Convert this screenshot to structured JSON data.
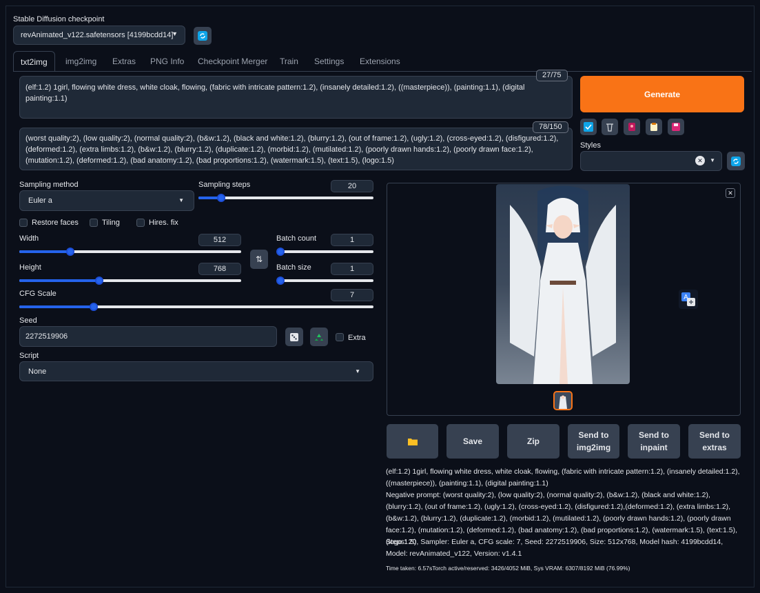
{
  "checkpoint": {
    "label": "Stable Diffusion checkpoint",
    "value": "revAnimated_v122.safetensors [4199bcdd14]"
  },
  "tabs": [
    {
      "label": "txt2img"
    },
    {
      "label": "img2img"
    },
    {
      "label": "Extras"
    },
    {
      "label": "PNG Info"
    },
    {
      "label": "Checkpoint Merger"
    },
    {
      "label": "Train"
    },
    {
      "label": "Settings"
    },
    {
      "label": "Extensions"
    }
  ],
  "prompt": {
    "value": "(elf:1.2) 1girl, flowing white dress, white cloak, flowing, (fabric with intricate pattern:1.2), (insanely detailed:1.2), ((masterpiece)), (painting:1.1), (digital painting:1.1)",
    "token_count": "27/75"
  },
  "negative_prompt": {
    "value": "(worst quality:2), (low quality:2), (normal quality:2), (b&w:1.2), (black and white:1.2), (blurry:1.2), (out of frame:1.2), (ugly:1.2), (cross-eyed:1.2), (disfigured:1.2),(deformed:1.2), (extra limbs:1.2), (b&w:1.2), (blurry:1.2), (duplicate:1.2), (morbid:1.2), (mutilated:1.2), (poorly drawn hands:1.2), (poorly drawn face:1.2), (mutation:1.2), (deformed:1.2), (bad anatomy:1.2), (bad proportions:1.2), (watermark:1.5), (text:1.5), (logo:1.5)",
    "token_count": "78/150"
  },
  "generate_label": "Generate",
  "styles_label": "Styles",
  "sampling": {
    "method_label": "Sampling method",
    "method_value": "Euler a",
    "steps_label": "Sampling steps",
    "steps_value": "20",
    "steps_fraction": 0.13
  },
  "checkboxes": {
    "restore_faces": "Restore faces",
    "tiling": "Tiling",
    "hires_fix": "Hires. fix",
    "extra": "Extra"
  },
  "width": {
    "label": "Width",
    "value": "512",
    "fraction": 0.23
  },
  "height": {
    "label": "Height",
    "value": "768",
    "fraction": 0.36
  },
  "batch_count": {
    "label": "Batch count",
    "value": "1",
    "fraction": 0.0
  },
  "batch_size": {
    "label": "Batch size",
    "value": "1",
    "fraction": 0.0
  },
  "cfg_scale": {
    "label": "CFG Scale",
    "value": "7",
    "fraction": 0.21
  },
  "seed": {
    "label": "Seed",
    "value": "2272519906"
  },
  "script": {
    "label": "Script",
    "value": "None"
  },
  "output_buttons": {
    "save": "Save",
    "zip": "Zip",
    "send_img2img": "Send to img2img",
    "send_inpaint": "Send to inpaint",
    "send_extras": "Send to extras"
  },
  "info": {
    "prompt_line": "(elf:1.2) 1girl, flowing white dress, white cloak, flowing, (fabric with intricate pattern:1.2), (insanely detailed:1.2), ((masterpiece)), (painting:1.1), (digital painting:1.1)",
    "negative_line": "Negative prompt: (worst quality:2), (low quality:2), (normal quality:2), (b&w:1.2), (black and white:1.2), (blurry:1.2), (out of frame:1.2), (ugly:1.2), (cross-eyed:1.2), (disfigured:1.2),(deformed:1.2), (extra limbs:1.2), (b&w:1.2), (blurry:1.2), (duplicate:1.2), (morbid:1.2), (mutilated:1.2), (poorly drawn hands:1.2), (poorly drawn face:1.2), (mutation:1.2), (deformed:1.2), (bad anatomy:1.2), (bad proportions:1.2), (watermark:1.5), (text:1.5), (logo:1.5)",
    "params_line": "Steps: 20, Sampler: Euler a, CFG scale: 7, Seed: 2272519906, Size: 512x768, Model hash: 4199bcdd14, Model: revAnimated_v122, Version: v1.4.1",
    "time_line": "Time taken: 6.57sTorch active/reserved: 3426/4052 MiB, Sys VRAM: 6307/8192 MiB (76.99%)"
  },
  "colors": {
    "background": "#0b0f19",
    "panel": "#1f2937",
    "accent_orange": "#f97316",
    "slider_blue": "#2563eb"
  }
}
